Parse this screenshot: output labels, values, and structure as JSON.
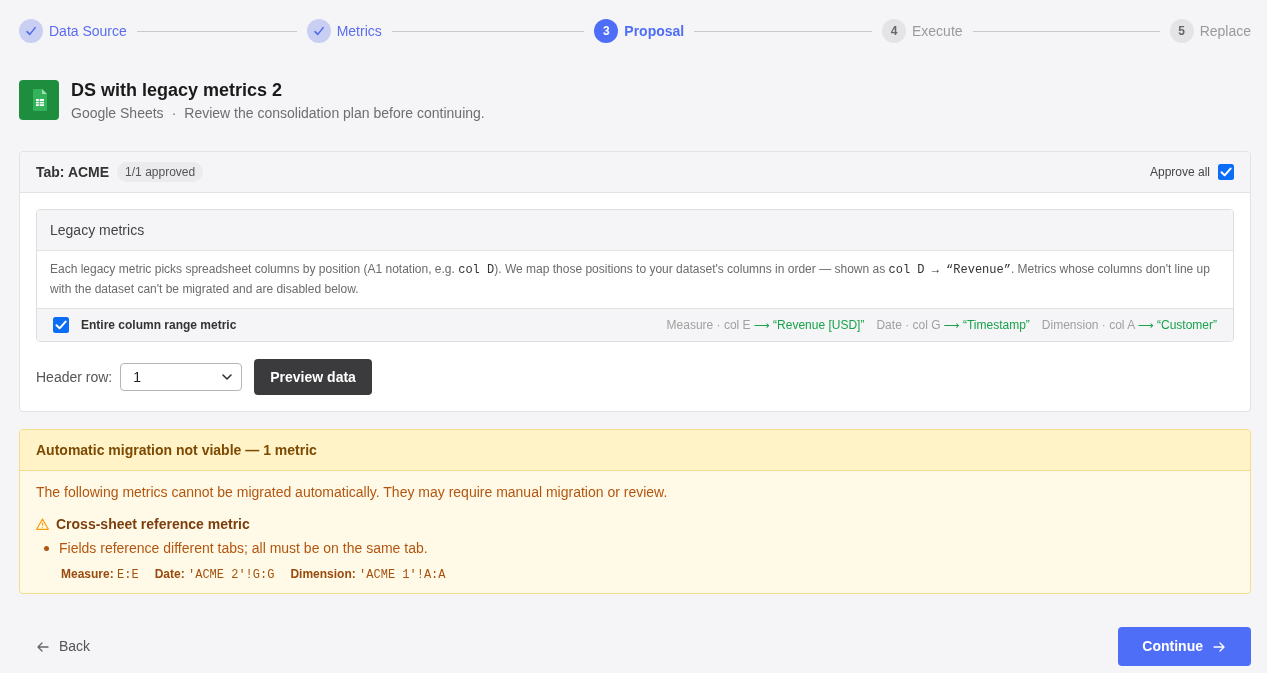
{
  "steps": [
    {
      "label": "Data Source",
      "completed": true,
      "selected": false
    },
    {
      "label": "Metrics",
      "completed": true,
      "selected": false
    },
    {
      "number": "3",
      "label": "Proposal",
      "completed": false,
      "selected": true
    },
    {
      "number": "4",
      "label": "Execute",
      "completed": false,
      "selected": false
    },
    {
      "number": "5",
      "label": "Replace",
      "completed": false,
      "selected": false
    }
  ],
  "header": {
    "title": "DS with legacy metrics 2",
    "source": "Google Sheets",
    "separator": "·",
    "description": "Review the consolidation plan before continuing."
  },
  "tab": {
    "title": "Tab: ACME",
    "badge": "1/1 approved",
    "approve_all": {
      "label": "Approve all",
      "checked": true
    },
    "legacy_metrics": {
      "title": "Legacy metrics",
      "description": [
        {
          "kind": "text",
          "text": "Each legacy metric picks spreadsheet columns by position (A1 notation, e.g. "
        },
        {
          "kind": "code",
          "text": "col D"
        },
        {
          "kind": "text",
          "text": "). We map those positions to your dataset's columns in order — shown as "
        },
        {
          "kind": "code",
          "text": "col D → “Revenue”"
        },
        {
          "kind": "text",
          "text": ". Metrics whose columns don't line up with the dataset can't be migrated and are disabled below."
        }
      ],
      "metrics": [
        {
          "name": "Entire column range metric",
          "checked": true,
          "mappings": [
            {
              "source": "Measure · col E",
              "arrow": "⟶",
              "target": "“Revenue [USD]”"
            },
            {
              "source": "Date · col G",
              "arrow": "⟶",
              "target": "“Timestamp”"
            },
            {
              "source": "Dimension · col A",
              "arrow": "⟶",
              "target": "“Customer”"
            }
          ]
        }
      ]
    },
    "header_row": {
      "label": "Header row:",
      "value": "1"
    },
    "preview_button": "Preview data"
  },
  "warning": {
    "title": "Automatic migration not viable — 1 metric",
    "message": "The following metrics cannot be migrated automatically. They may require manual migration or review.",
    "metrics": [
      {
        "name": "Cross-sheet reference metric",
        "reasons": [
          "Fields reference different tabs; all must be on the same tab."
        ],
        "fields": [
          {
            "label": "Measure:",
            "value": "E:E"
          },
          {
            "label": "Date:",
            "value": "'ACME 2'!G:G"
          },
          {
            "label": "Dimension:",
            "value": "'ACME 1'!A:A"
          }
        ]
      }
    ]
  },
  "footer": {
    "back": "Back",
    "continue": "Continue"
  }
}
